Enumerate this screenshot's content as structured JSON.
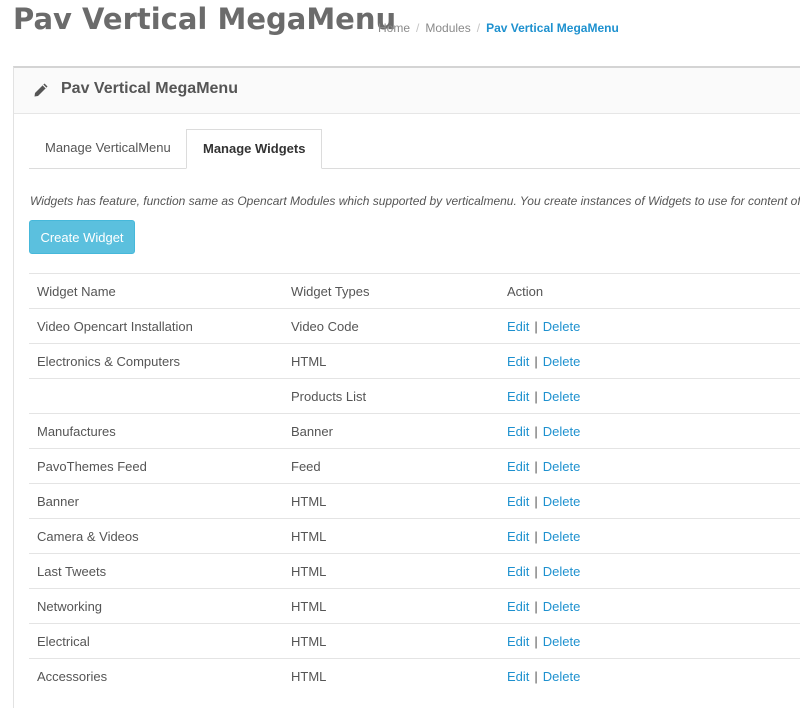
{
  "header": {
    "title": "Pav Vertical MegaMenu",
    "breadcrumb": [
      "Home",
      "Modules",
      "Pav Vertical MegaMenu"
    ],
    "breadcrumb_separator": "/"
  },
  "panel": {
    "icon": "pencil-icon",
    "title": "Pav Vertical MegaMenu"
  },
  "tabs": [
    {
      "label": "Manage VerticalMenu",
      "active": false
    },
    {
      "label": "Manage Widgets",
      "active": true
    }
  ],
  "description": "Widgets has feature, function same as Opencart Modules which supported by verticalmenu. You create instances of Widgets to use for content of su",
  "create_button": "Create Widget",
  "table": {
    "columns": [
      "Widget Name",
      "Widget Types",
      "Action"
    ],
    "action_edit": "Edit",
    "action_sep": "|",
    "action_delete": "Delete",
    "rows": [
      {
        "name": "Video Opencart Installation",
        "type": "Video Code"
      },
      {
        "name": "Electronics & Computers",
        "type": "HTML"
      },
      {
        "name": "",
        "type": "Products List"
      },
      {
        "name": "Manufactures",
        "type": "Banner"
      },
      {
        "name": "PavoThemes Feed",
        "type": "Feed"
      },
      {
        "name": "Banner",
        "type": "HTML"
      },
      {
        "name": "Camera & Videos",
        "type": "HTML"
      },
      {
        "name": "Last Tweets",
        "type": "HTML"
      },
      {
        "name": "Networking",
        "type": "HTML"
      },
      {
        "name": "Electrical",
        "type": "HTML"
      },
      {
        "name": "Accessories",
        "type": "HTML"
      }
    ]
  },
  "colors": {
    "accent": "#1e91cf",
    "button": "#5bc0de",
    "title": "#6b6b6b"
  }
}
